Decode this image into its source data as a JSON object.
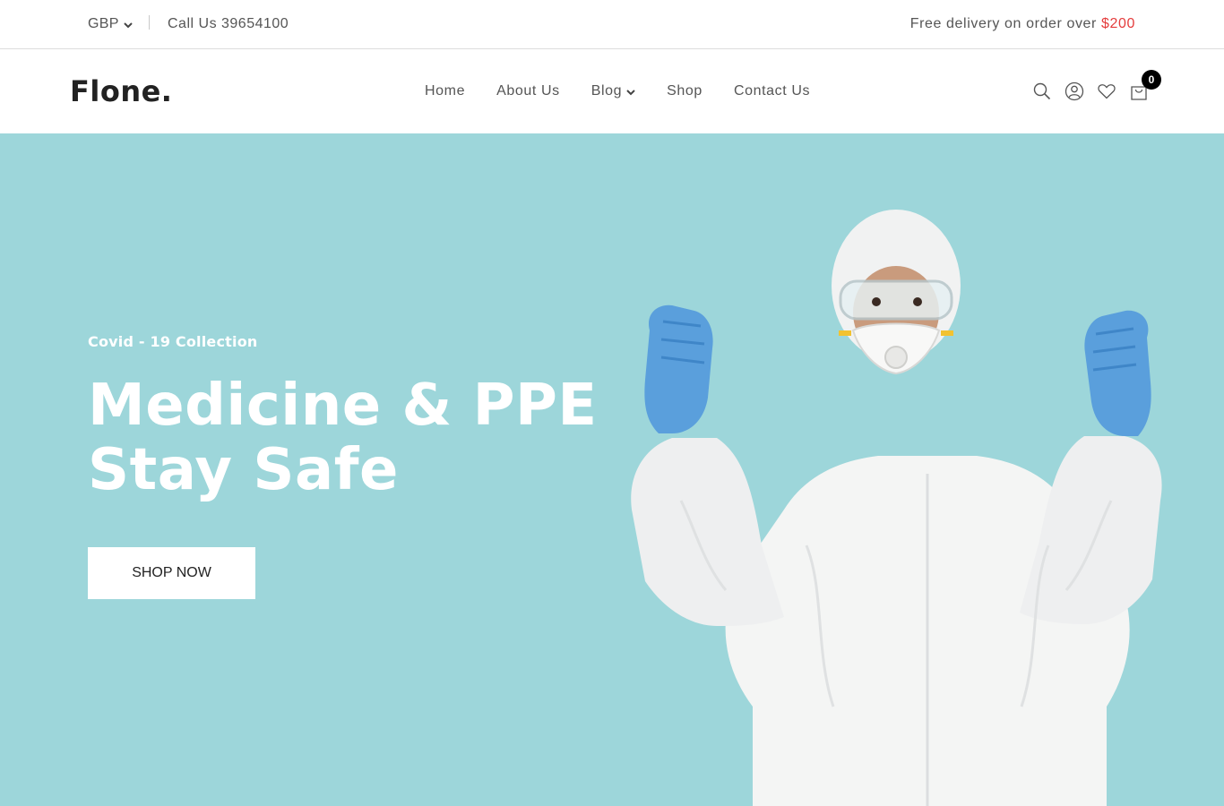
{
  "topbar": {
    "currency": "GBP",
    "call_text": "Call Us 39654100",
    "delivery_text": "Free delivery on order over",
    "delivery_amount": "$200"
  },
  "header": {
    "logo": "Flone.",
    "nav": [
      {
        "label": "Home"
      },
      {
        "label": "About Us"
      },
      {
        "label": "Blog",
        "has_dropdown": true
      },
      {
        "label": "Shop"
      },
      {
        "label": "Contact Us"
      }
    ],
    "icons": [
      "search-icon",
      "user-icon",
      "heart-icon",
      "cart-icon"
    ],
    "cart_count": "0"
  },
  "hero": {
    "subtitle": "Covid - 19 Collection",
    "headline_line1": "Medicine & PPE",
    "headline_line2": "Stay Safe",
    "button_label": "SHOP NOW",
    "background_color": "#9dd6da"
  },
  "colors": {
    "accent_price": "#e43c3c",
    "text": "#555555",
    "logo": "#222222"
  }
}
